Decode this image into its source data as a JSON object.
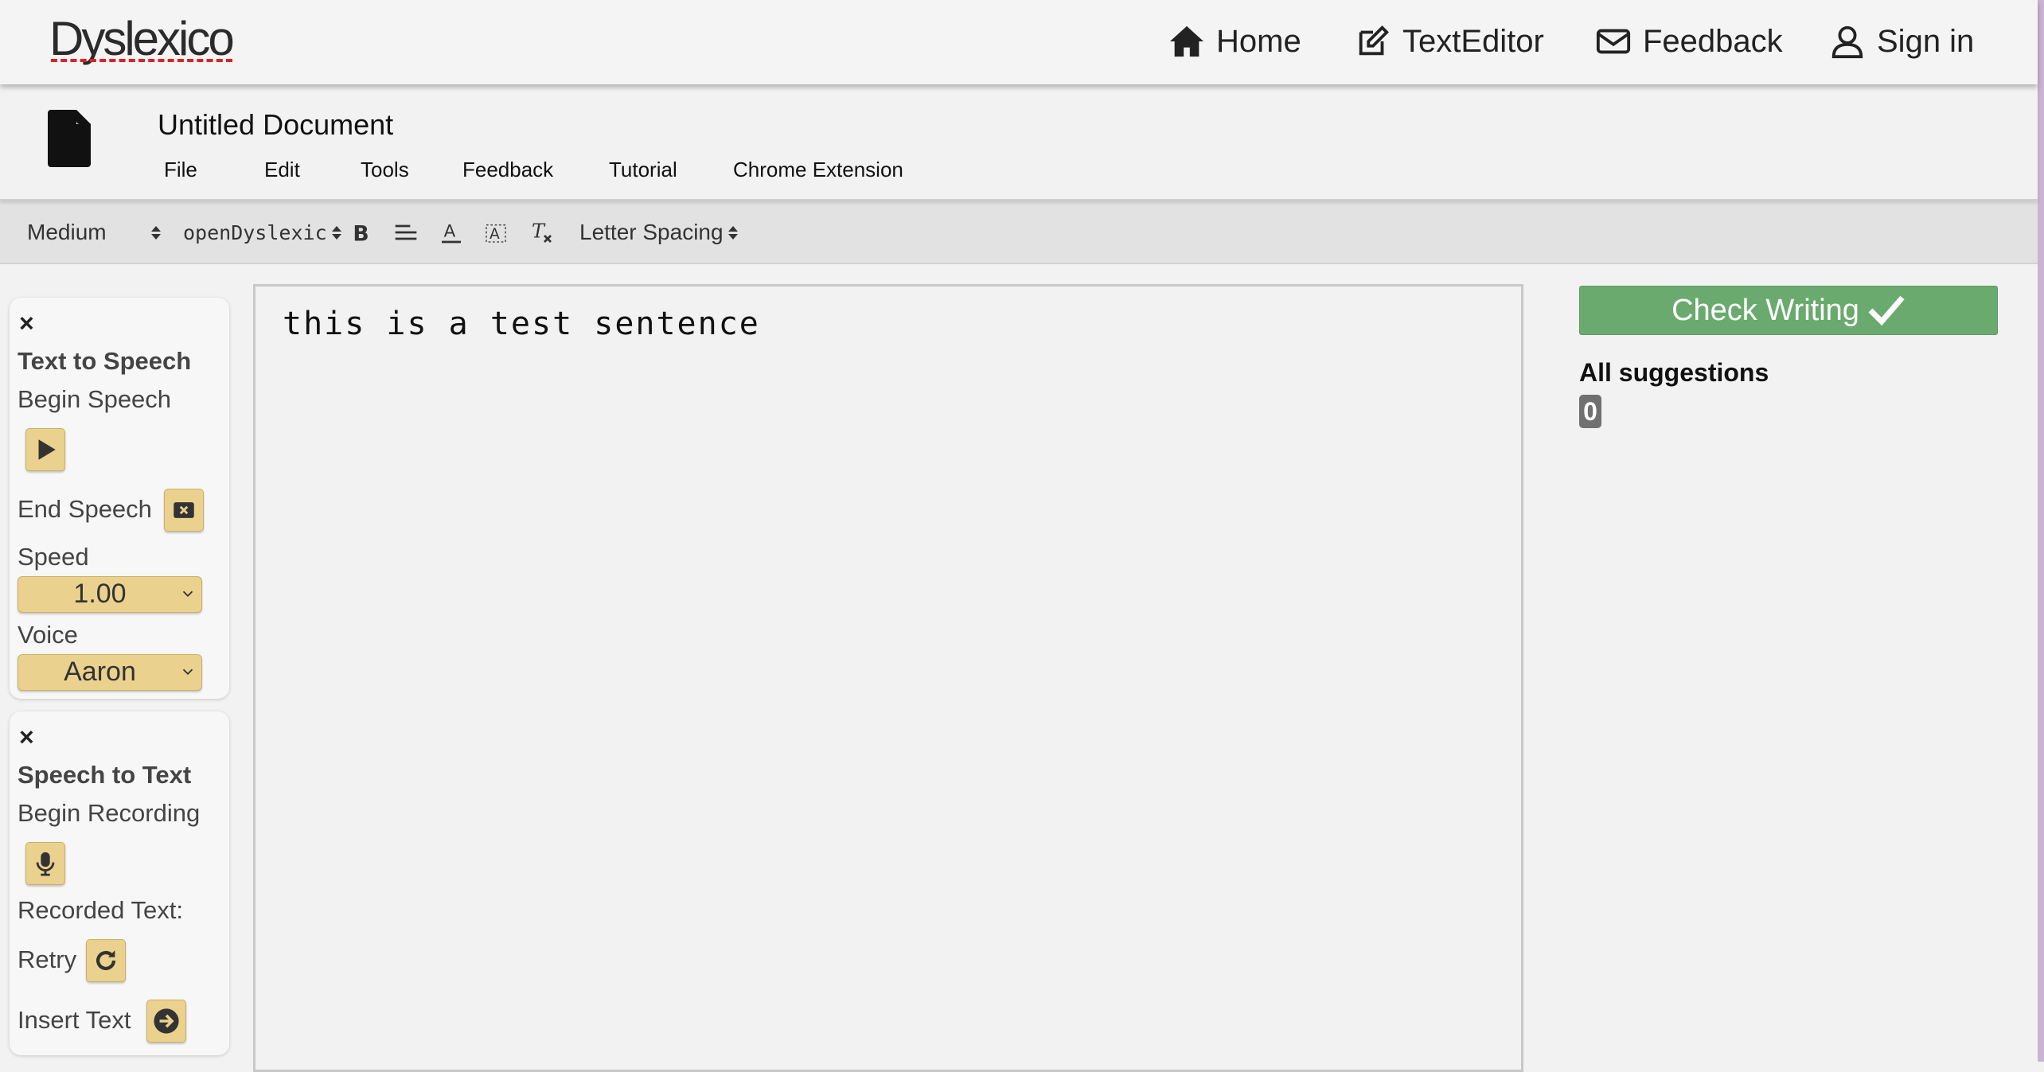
{
  "navbar": {
    "logo": "Dyslexico",
    "items": [
      {
        "label": "Home",
        "icon": "home-icon"
      },
      {
        "label": "TextEditor",
        "icon": "edit-icon"
      },
      {
        "label": "Feedback",
        "icon": "envelope-icon"
      },
      {
        "label": "Sign in",
        "icon": "user-icon"
      }
    ]
  },
  "document": {
    "title": "Untitled Document",
    "menu": [
      "File",
      "Edit",
      "Tools",
      "Feedback",
      "Tutorial",
      "Chrome Extension"
    ]
  },
  "toolbar": {
    "size": "Medium",
    "font": "openDyslexic",
    "letter_spacing": "Letter Spacing",
    "icons": [
      "bold-icon",
      "align-left-icon",
      "font-color-icon",
      "highlight-icon",
      "clear-format-icon"
    ]
  },
  "tts_panel": {
    "close": "×",
    "heading": "Text to Speech",
    "begin_label": "Begin Speech",
    "end_label": "End Speech",
    "speed_label": "Speed",
    "speed_value": "1.00",
    "voice_label": "Voice",
    "voice_value": "Aaron"
  },
  "stt_panel": {
    "close": "×",
    "heading": "Speech to Text",
    "begin_label": "Begin Recording",
    "recorded_label": "Recorded Text:",
    "retry_label": "Retry",
    "insert_label": "Insert Text"
  },
  "editor": {
    "content": "this is a test sentence"
  },
  "suggestions": {
    "check_button": "Check Writing",
    "title": "All suggestions",
    "count": "0"
  },
  "colors": {
    "accent_yellow": "#ead18e",
    "check_green": "#6aaa6e",
    "logo_underline": "#e02020"
  }
}
